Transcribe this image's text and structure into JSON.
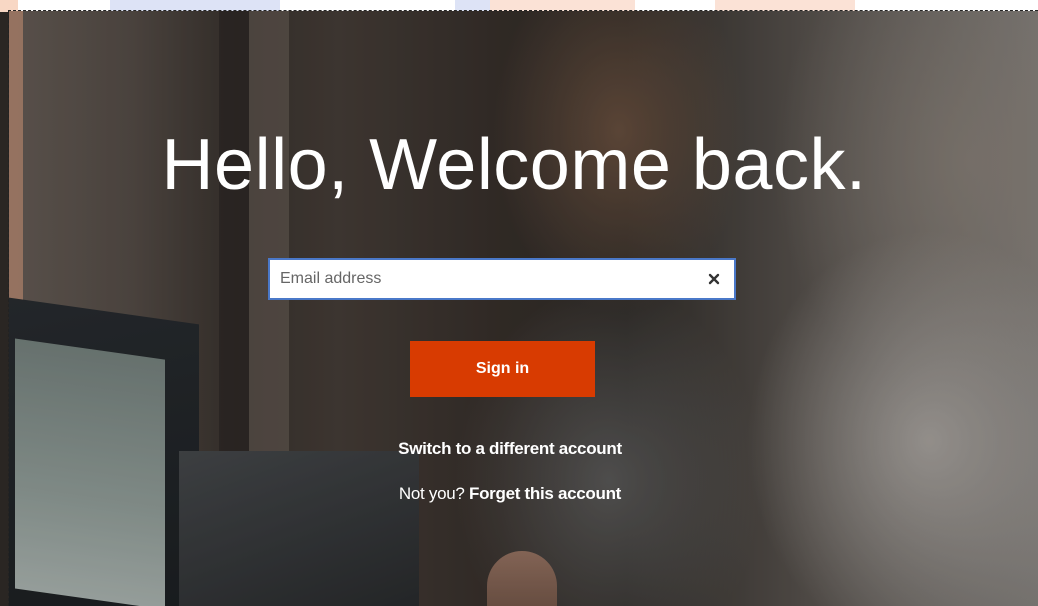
{
  "page": {
    "title": "Hello, Welcome back.",
    "accent_color": "#d83b01"
  },
  "email": {
    "placeholder": "Email address",
    "value": "",
    "clear_icon": "close-icon"
  },
  "actions": {
    "sign_in_label": "Sign in",
    "switch_account_label": "Switch to a different account",
    "not_you_prefix": "Not you?",
    "forget_account_label": "Forget this account"
  }
}
